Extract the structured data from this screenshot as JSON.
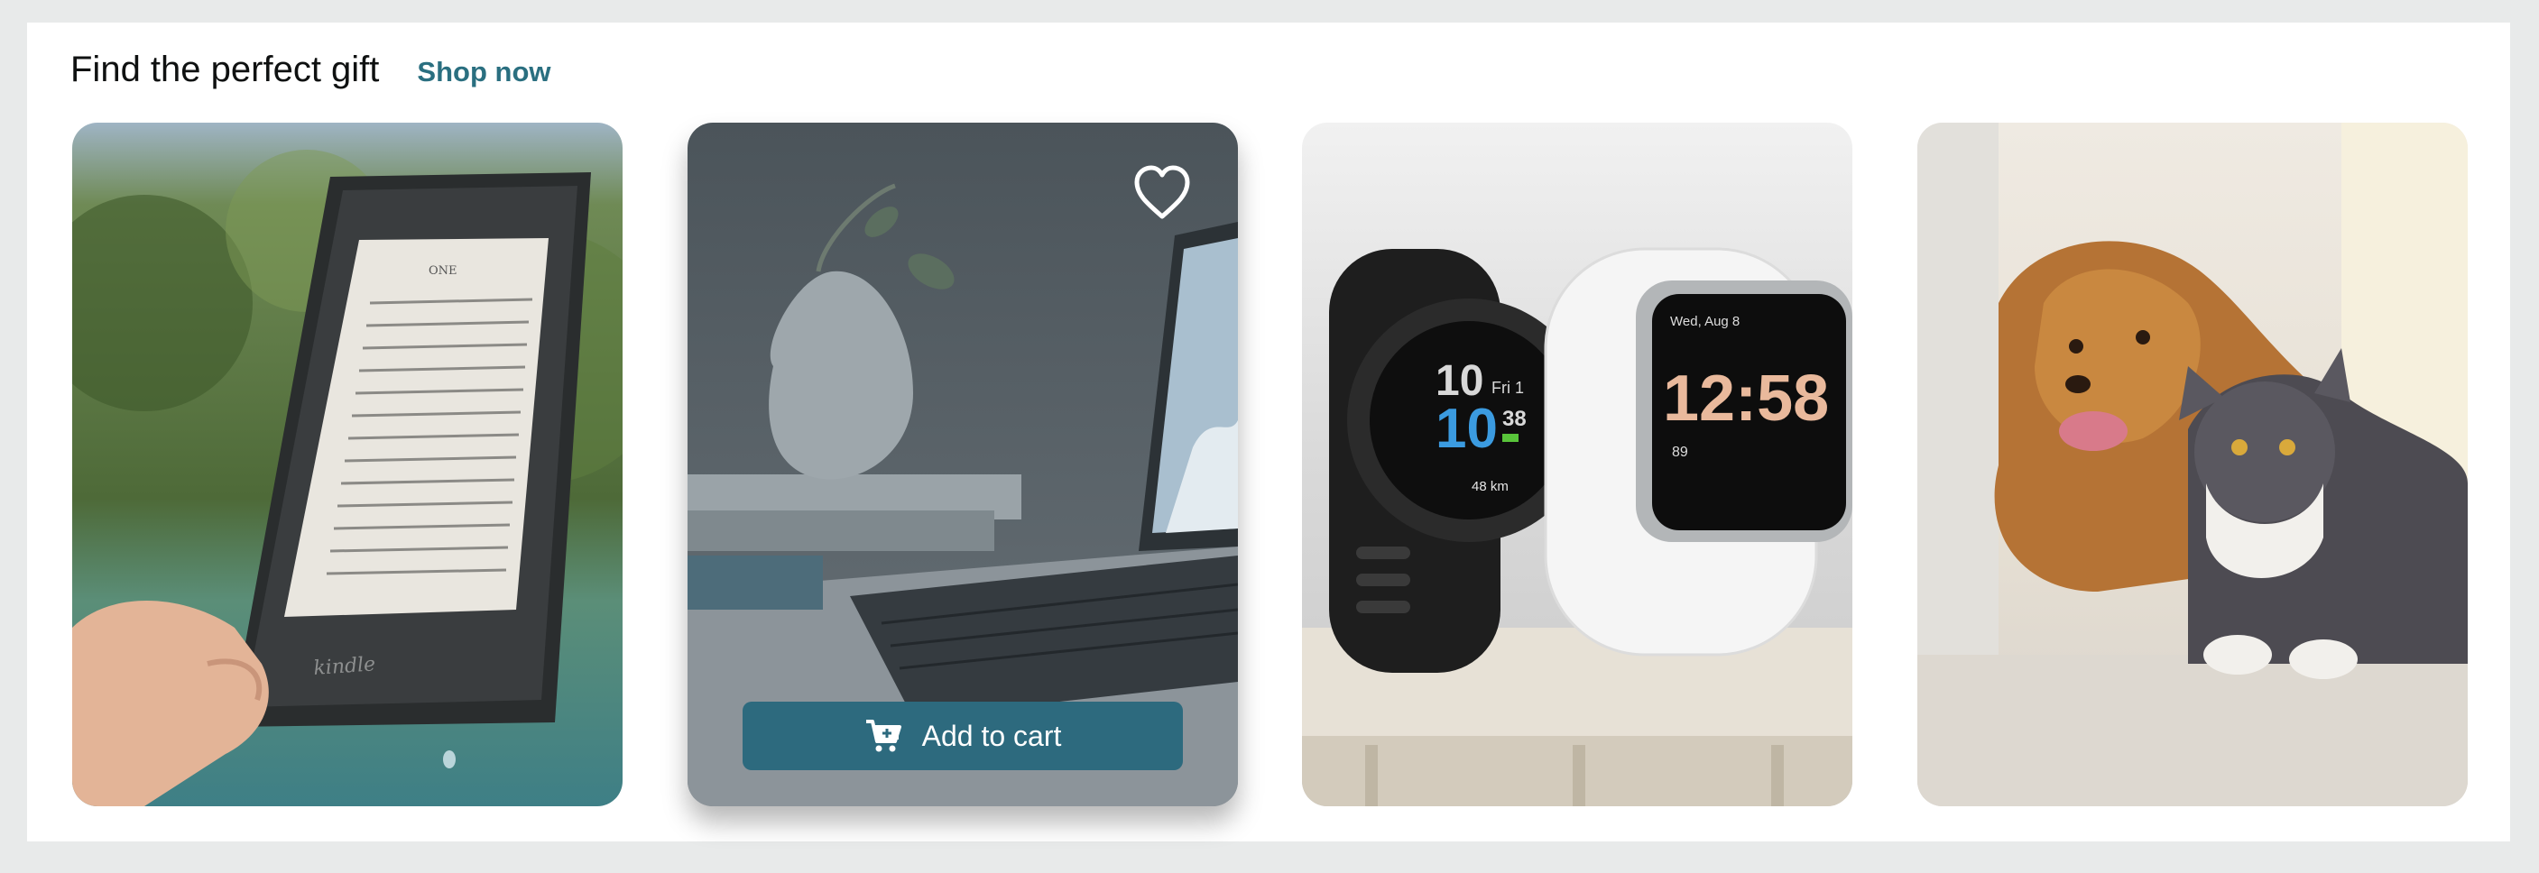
{
  "section": {
    "title": "Find the perfect gift",
    "shop_link": "Shop now"
  },
  "cards": [
    {
      "label": "Kindle e-reader",
      "screen_heading": "ONE",
      "brand": "kindle"
    },
    {
      "label": "Laptop",
      "add_to_cart": "Add to cart",
      "favorite_icon": "heart-outline-icon",
      "cart_icon": "cart-plus-icon"
    },
    {
      "label": "Smart watches",
      "watch1": {
        "time_hour": "10",
        "time_min": "10",
        "seconds": "38",
        "date": "Fri 1",
        "distance": "48 km"
      },
      "watch2": {
        "date": "Wed, Aug 8",
        "time": "12:58",
        "stat": "89"
      }
    },
    {
      "label": "Dog and cat"
    }
  ],
  "colors": {
    "accent": "#2a6f80",
    "button": "#2d6a7e",
    "page_bg": "#e8eaea",
    "panel_bg": "#ffffff"
  }
}
